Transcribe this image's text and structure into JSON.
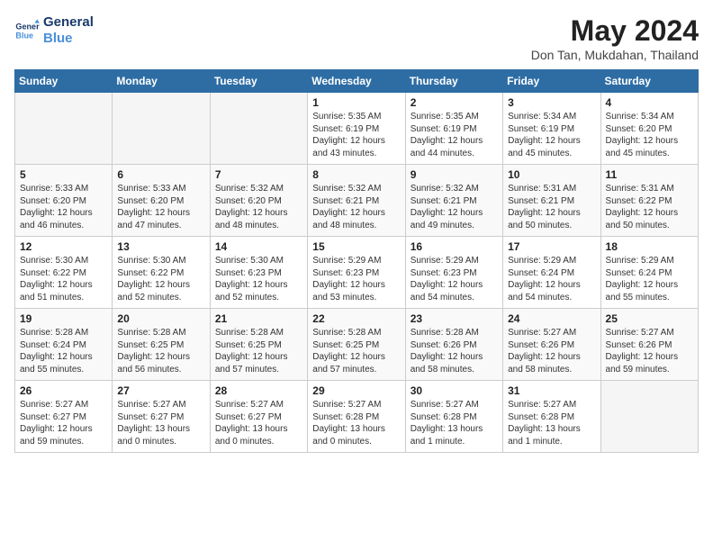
{
  "header": {
    "logo_line1": "General",
    "logo_line2": "Blue",
    "month_title": "May 2024",
    "location": "Don Tan, Mukdahan, Thailand"
  },
  "weekdays": [
    "Sunday",
    "Monday",
    "Tuesday",
    "Wednesday",
    "Thursday",
    "Friday",
    "Saturday"
  ],
  "weeks": [
    [
      {
        "day": "",
        "text": ""
      },
      {
        "day": "",
        "text": ""
      },
      {
        "day": "",
        "text": ""
      },
      {
        "day": "1",
        "text": "Sunrise: 5:35 AM\nSunset: 6:19 PM\nDaylight: 12 hours\nand 43 minutes."
      },
      {
        "day": "2",
        "text": "Sunrise: 5:35 AM\nSunset: 6:19 PM\nDaylight: 12 hours\nand 44 minutes."
      },
      {
        "day": "3",
        "text": "Sunrise: 5:34 AM\nSunset: 6:19 PM\nDaylight: 12 hours\nand 45 minutes."
      },
      {
        "day": "4",
        "text": "Sunrise: 5:34 AM\nSunset: 6:20 PM\nDaylight: 12 hours\nand 45 minutes."
      }
    ],
    [
      {
        "day": "5",
        "text": "Sunrise: 5:33 AM\nSunset: 6:20 PM\nDaylight: 12 hours\nand 46 minutes."
      },
      {
        "day": "6",
        "text": "Sunrise: 5:33 AM\nSunset: 6:20 PM\nDaylight: 12 hours\nand 47 minutes."
      },
      {
        "day": "7",
        "text": "Sunrise: 5:32 AM\nSunset: 6:20 PM\nDaylight: 12 hours\nand 48 minutes."
      },
      {
        "day": "8",
        "text": "Sunrise: 5:32 AM\nSunset: 6:21 PM\nDaylight: 12 hours\nand 48 minutes."
      },
      {
        "day": "9",
        "text": "Sunrise: 5:32 AM\nSunset: 6:21 PM\nDaylight: 12 hours\nand 49 minutes."
      },
      {
        "day": "10",
        "text": "Sunrise: 5:31 AM\nSunset: 6:21 PM\nDaylight: 12 hours\nand 50 minutes."
      },
      {
        "day": "11",
        "text": "Sunrise: 5:31 AM\nSunset: 6:22 PM\nDaylight: 12 hours\nand 50 minutes."
      }
    ],
    [
      {
        "day": "12",
        "text": "Sunrise: 5:30 AM\nSunset: 6:22 PM\nDaylight: 12 hours\nand 51 minutes."
      },
      {
        "day": "13",
        "text": "Sunrise: 5:30 AM\nSunset: 6:22 PM\nDaylight: 12 hours\nand 52 minutes."
      },
      {
        "day": "14",
        "text": "Sunrise: 5:30 AM\nSunset: 6:23 PM\nDaylight: 12 hours\nand 52 minutes."
      },
      {
        "day": "15",
        "text": "Sunrise: 5:29 AM\nSunset: 6:23 PM\nDaylight: 12 hours\nand 53 minutes."
      },
      {
        "day": "16",
        "text": "Sunrise: 5:29 AM\nSunset: 6:23 PM\nDaylight: 12 hours\nand 54 minutes."
      },
      {
        "day": "17",
        "text": "Sunrise: 5:29 AM\nSunset: 6:24 PM\nDaylight: 12 hours\nand 54 minutes."
      },
      {
        "day": "18",
        "text": "Sunrise: 5:29 AM\nSunset: 6:24 PM\nDaylight: 12 hours\nand 55 minutes."
      }
    ],
    [
      {
        "day": "19",
        "text": "Sunrise: 5:28 AM\nSunset: 6:24 PM\nDaylight: 12 hours\nand 55 minutes."
      },
      {
        "day": "20",
        "text": "Sunrise: 5:28 AM\nSunset: 6:25 PM\nDaylight: 12 hours\nand 56 minutes."
      },
      {
        "day": "21",
        "text": "Sunrise: 5:28 AM\nSunset: 6:25 PM\nDaylight: 12 hours\nand 57 minutes."
      },
      {
        "day": "22",
        "text": "Sunrise: 5:28 AM\nSunset: 6:25 PM\nDaylight: 12 hours\nand 57 minutes."
      },
      {
        "day": "23",
        "text": "Sunrise: 5:28 AM\nSunset: 6:26 PM\nDaylight: 12 hours\nand 58 minutes."
      },
      {
        "day": "24",
        "text": "Sunrise: 5:27 AM\nSunset: 6:26 PM\nDaylight: 12 hours\nand 58 minutes."
      },
      {
        "day": "25",
        "text": "Sunrise: 5:27 AM\nSunset: 6:26 PM\nDaylight: 12 hours\nand 59 minutes."
      }
    ],
    [
      {
        "day": "26",
        "text": "Sunrise: 5:27 AM\nSunset: 6:27 PM\nDaylight: 12 hours\nand 59 minutes."
      },
      {
        "day": "27",
        "text": "Sunrise: 5:27 AM\nSunset: 6:27 PM\nDaylight: 13 hours\nand 0 minutes."
      },
      {
        "day": "28",
        "text": "Sunrise: 5:27 AM\nSunset: 6:27 PM\nDaylight: 13 hours\nand 0 minutes."
      },
      {
        "day": "29",
        "text": "Sunrise: 5:27 AM\nSunset: 6:28 PM\nDaylight: 13 hours\nand 0 minutes."
      },
      {
        "day": "30",
        "text": "Sunrise: 5:27 AM\nSunset: 6:28 PM\nDaylight: 13 hours\nand 1 minute."
      },
      {
        "day": "31",
        "text": "Sunrise: 5:27 AM\nSunset: 6:28 PM\nDaylight: 13 hours\nand 1 minute."
      },
      {
        "day": "",
        "text": ""
      }
    ]
  ]
}
